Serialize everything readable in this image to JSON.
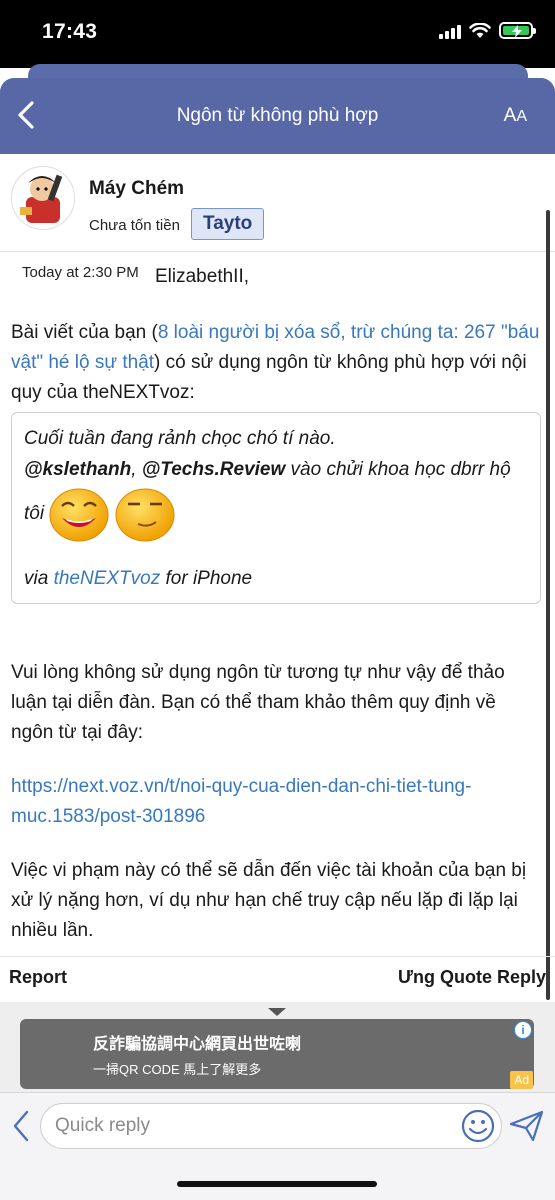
{
  "status_bar": {
    "time": "17:43",
    "icons": [
      "signal-icon",
      "wifi-icon",
      "battery-charging-icon"
    ],
    "battery_color": "#34c759"
  },
  "nav": {
    "title": "Ngôn từ không phù hợp",
    "back_icon": "chevron-left-icon",
    "font_size_label_large": "A",
    "font_size_label_small": "A",
    "bar_color": "#5868a7"
  },
  "author": {
    "name": "Máy Chém",
    "rank": "Chưa tốn tiền",
    "badge": "Tayto"
  },
  "message": {
    "timestamp": "Today at 2:30 PM",
    "recipient": "ElizabethII,",
    "intro_prefix": "Bài viết của bạn (",
    "intro_link": "8 loài người bị xóa sổ, trừ chúng ta: 267 \"báu vật\" hé lộ sự thật",
    "intro_suffix": ") có sử dụng ngôn từ không phù hợp với nội quy của theNEXTvoz:",
    "quote": {
      "line1": "Cuối tuần đang rảnh chọc chó tí nào.",
      "mention1": "@kslethanh",
      "separator": ", ",
      "mention2": "@Techs.Review",
      "line2_rest": " vào chửi khoa học dbrr hộ",
      "line3": "tôi",
      "emojis": [
        "grinning-face-icon",
        "smirking-face-icon"
      ],
      "via_prefix": "via ",
      "via_link": "theNEXTvoz",
      "via_suffix": " for iPhone"
    },
    "request": "Vui lòng không sử dụng ngôn từ tương tự như vậy để thảo luận tại diễn đàn. Bạn có thể tham khảo thêm quy định về ngôn từ tại đây:",
    "rules_link": "https://next.voz.vn/t/noi-quy-cua-dien-dan-chi-tiet-tung-muc.1583/post-301896",
    "warning": "Việc vi phạm này có thể sẽ dẫn đến việc tài khoản của bạn bị xử lý nặng hơn, ví dụ như hạn chế truy cập nếu lặp đi lặp lại nhiều lần."
  },
  "actions": {
    "report": "Report",
    "ung": "Ưng",
    "quote": "Quote",
    "reply": "Reply"
  },
  "ad": {
    "title": "反詐騙協調中心網頁出世咗喇",
    "subtitle": "一掃QR CODE 馬上了解更多",
    "info": "i",
    "badge": "Ad"
  },
  "reply_bar": {
    "placeholder": "Quick reply"
  }
}
